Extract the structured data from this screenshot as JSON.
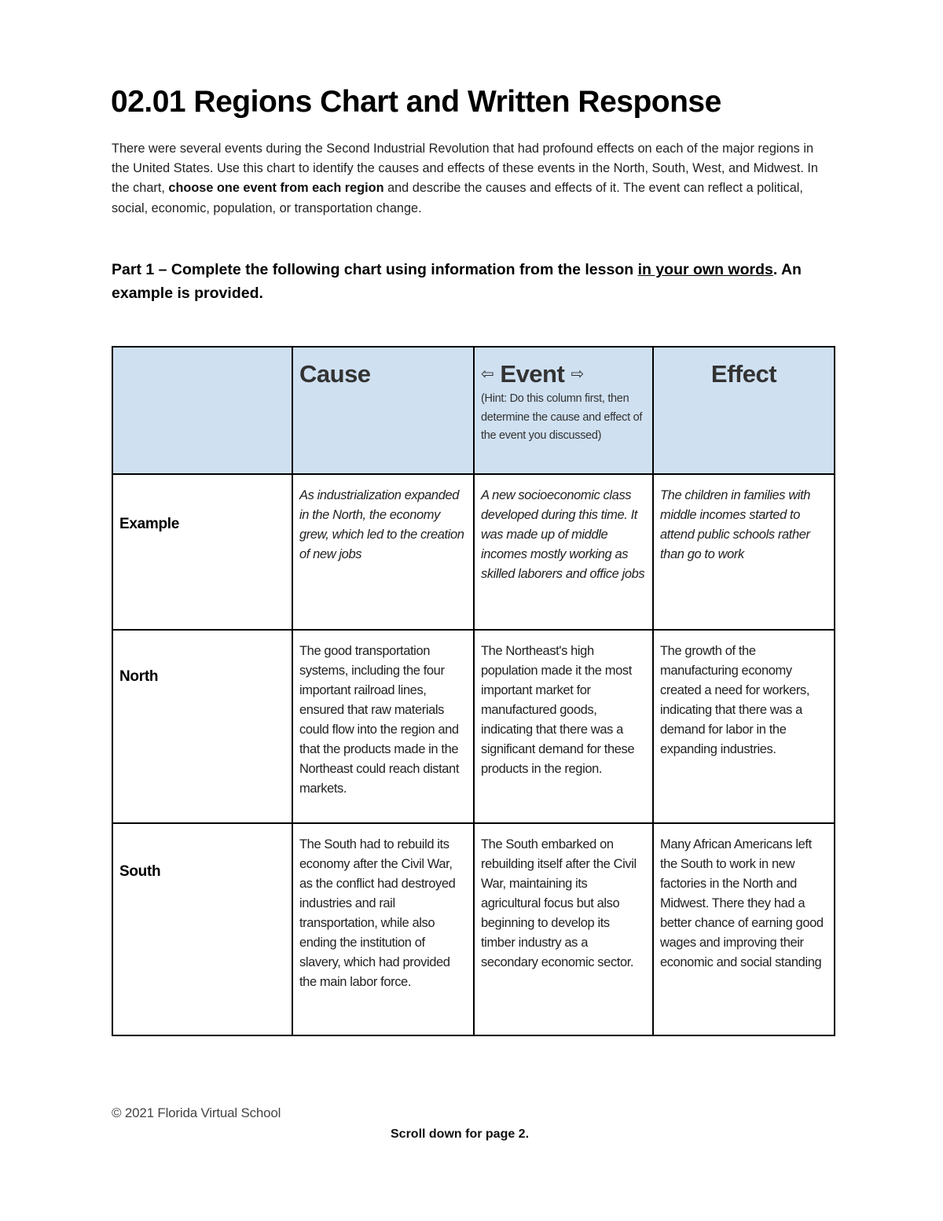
{
  "document": {
    "title": "02.01 Regions Chart and Written Response",
    "intro": {
      "part1": "There were several events during the Second Industrial Revolution that had profound effects on each of the major regions in the United States. Use this chart to identify the causes and effects of these events in the North, South, West, and Midwest. In the chart, ",
      "bold": "choose one event from each region",
      "part2": " and describe the causes and effects of it. The event can reflect a political, social, economic, population, or transportation change."
    },
    "part1_heading": {
      "text_before": "Part 1 – Complete the following chart using information from the lesson ",
      "underlined": "in your own words",
      "text_after": ". An example is provided."
    },
    "table": {
      "header_bg": "#cfe0f1",
      "headers": {
        "cause": "Cause",
        "event_left_arrow": "⇦",
        "event": "Event",
        "event_right_arrow": "⇨",
        "event_hint": "(Hint: Do this column first, then determine the cause and effect of the event you discussed)",
        "effect": "Effect"
      },
      "rows": [
        {
          "label": "Example",
          "cause": "As industrialization expanded in the North, the economy grew, which led to the creation of new jobs",
          "event": "A new socioeconomic class developed during this time.  It was made up of middle incomes mostly working as skilled laborers and office jobs",
          "effect": "The children in families with middle incomes started to attend public schools rather than go to work"
        },
        {
          "label": "North",
          "cause": "The good transportation systems, including the four important railroad lines, ensured that raw materials could flow into the region and that the products made in the Northeast could reach distant markets.",
          "event": "The Northeast's high population made it the most important market for manufactured goods, indicating that there was a significant demand for these products in the region.",
          "effect": "The growth of the manufacturing economy created a need for workers, indicating that there was a demand for labor in the expanding industries."
        },
        {
          "label": "South",
          "cause": "The South had to rebuild its economy after the Civil War, as the conflict had destroyed industries and rail transportation, while also ending the institution of slavery, which had provided the main labor force.",
          "event": "The South embarked on rebuilding itself after the Civil War, maintaining its agricultural focus but also beginning to develop its timber industry as a secondary economic sector.",
          "effect": "Many African Americans left the South to work in new factories in the North and Midwest. There they had a better chance of earning good wages and improving their economic and social standing"
        }
      ]
    },
    "footer": {
      "copyright": "© 2021 Florida Virtual School",
      "scroll_note": "Scroll down for page 2."
    }
  }
}
